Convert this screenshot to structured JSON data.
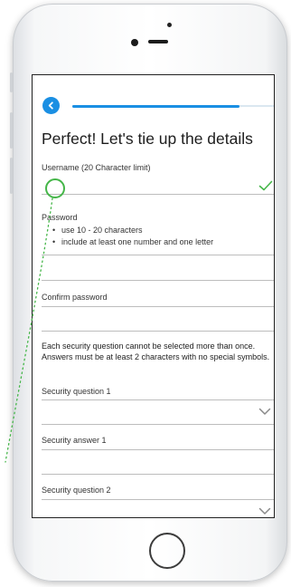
{
  "form": {
    "title": "Perfect! Let's tie up the details",
    "progress_fraction": 0.82,
    "username_label": "Username (20 Character limit)",
    "username_value": "",
    "password_label": "Password",
    "password_rules": [
      "use 10 - 20 characters",
      "include at least one number and one letter"
    ],
    "password_value": "",
    "confirm_label": "Confirm password",
    "confirm_value": "",
    "security_info": "Each security question cannot be selected more than once. Answers must be at least 2 characters with no special symbols.",
    "security_q1_label": "Security question 1",
    "security_a1_label": "Security answer 1",
    "security_q2_label": "Security question 2"
  },
  "colors": {
    "accent": "#1a8fe3",
    "valid": "#45b649",
    "annotation": "#45b649"
  },
  "icons": {
    "back": "chevron-left-icon",
    "valid": "check-icon",
    "dropdown": "chevron-down-icon"
  }
}
